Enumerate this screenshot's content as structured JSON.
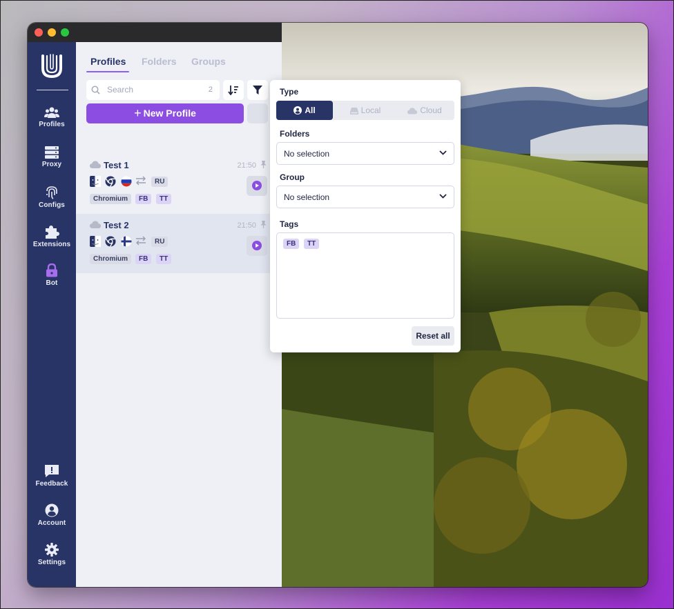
{
  "app": {
    "nav": [
      {
        "label": "Profiles",
        "icon": "profiles-icon"
      },
      {
        "label": "Proxy",
        "icon": "server-icon"
      },
      {
        "label": "Configs",
        "icon": "fingerprint-icon"
      },
      {
        "label": "Extensions",
        "icon": "puzzle-icon"
      },
      {
        "label": "Bot",
        "icon": "lock-icon"
      }
    ],
    "nav_bottom": [
      {
        "label": "Feedback",
        "icon": "feedback-icon"
      },
      {
        "label": "Account",
        "icon": "account-icon"
      },
      {
        "label": "Settings",
        "icon": "gear-icon"
      }
    ],
    "tabs": [
      "Profiles",
      "Folders",
      "Groups"
    ],
    "active_tab": "Profiles",
    "search": {
      "placeholder": "Search",
      "count": "2"
    },
    "new_profile_label": "New Profile",
    "profiles": [
      {
        "name": "Test 1",
        "time": "21:50",
        "country": "RU",
        "flag": "russia-flag",
        "browser": "Chromium",
        "tags": [
          "FB",
          "TT"
        ]
      },
      {
        "name": "Test 2",
        "time": "21:50",
        "country": "RU",
        "flag": "finland-flag",
        "browser": "Chromium",
        "tags": [
          "FB",
          "TT"
        ]
      }
    ],
    "filter": {
      "type_label": "Type",
      "type_options": [
        "All",
        "Local",
        "Cloud"
      ],
      "type_selected": "All",
      "folders_label": "Folders",
      "folders_value": "No selection",
      "group_label": "Group",
      "group_value": "No selection",
      "tags_label": "Tags",
      "tags": [
        "FB",
        "TT"
      ],
      "reset_label": "Reset all"
    }
  },
  "colors": {
    "sidebar": "#283366",
    "accent": "#8c4ee2",
    "tab_active": "#283366",
    "tab_inactive": "#b9bdd0"
  }
}
